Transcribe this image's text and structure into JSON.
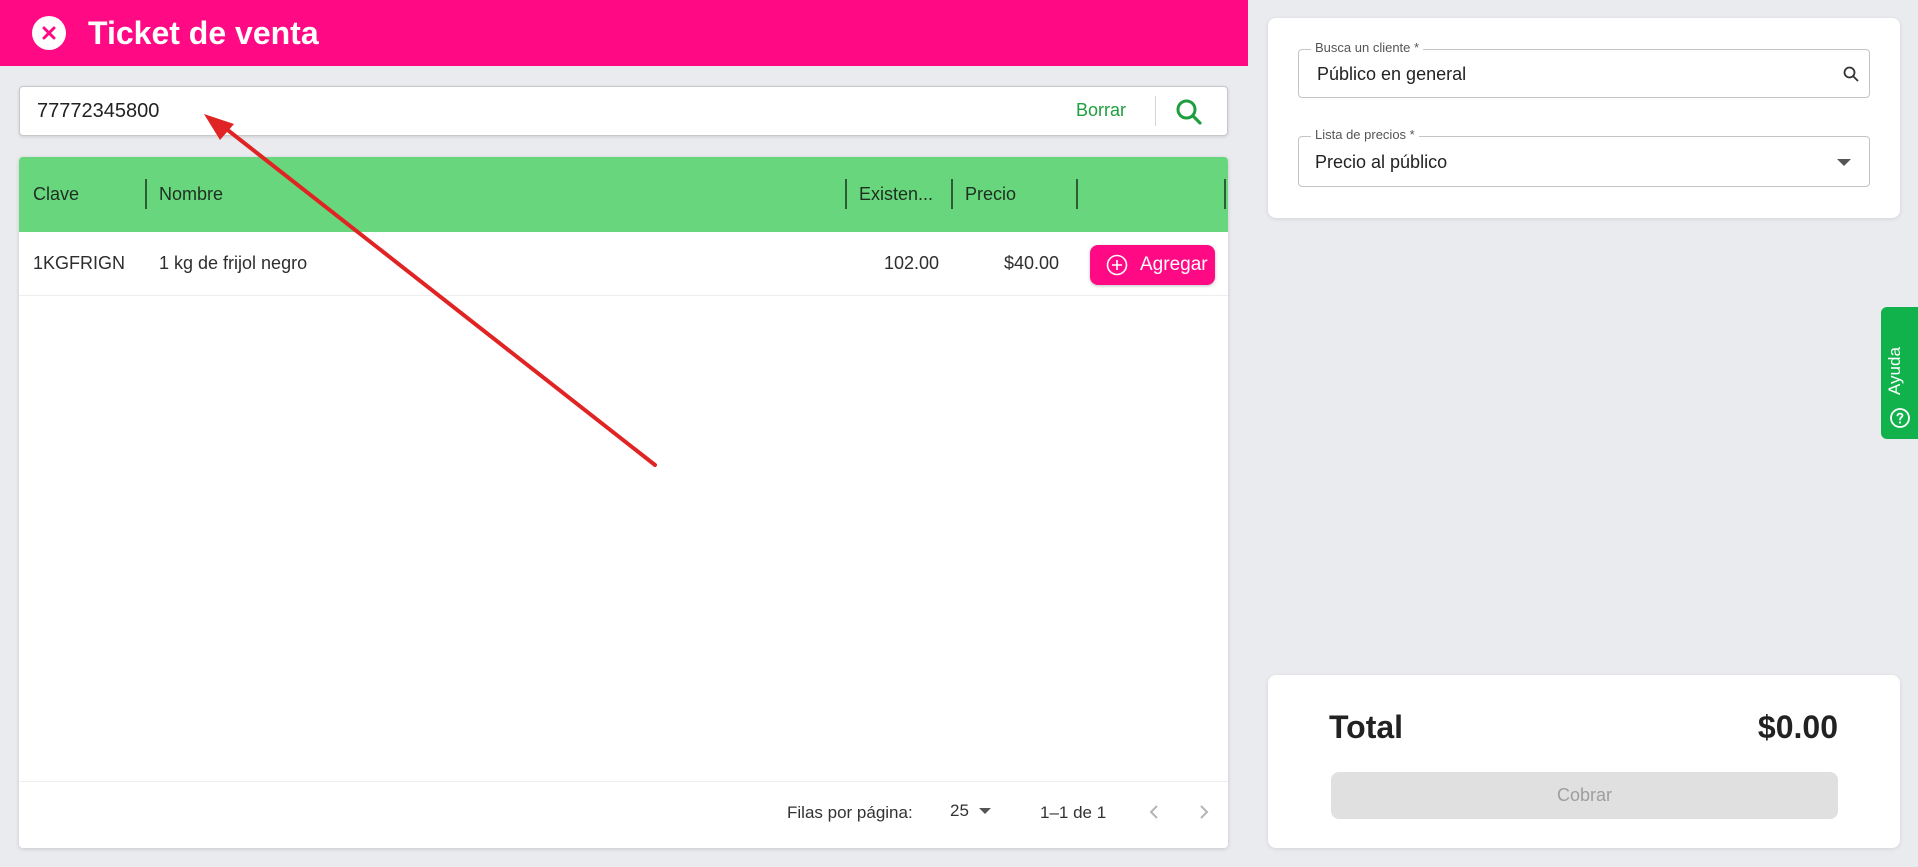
{
  "header": {
    "title": "Ticket de venta"
  },
  "search": {
    "value": "77772345800",
    "clear_label": "Borrar"
  },
  "table": {
    "columns": [
      "Clave",
      "Nombre",
      "Existen...",
      "Precio"
    ],
    "rows": [
      {
        "clave": "1KGFRIGN",
        "nombre": "1 kg de frijol negro",
        "existencia": "102.00",
        "precio": "$40.00",
        "action_label": "Agregar"
      }
    ],
    "pagination": {
      "rows_label": "Filas por página:",
      "rows_value": "25",
      "range": "1–1 de 1"
    }
  },
  "client": {
    "label": "Busca un cliente *",
    "value": "Público en general"
  },
  "price_list": {
    "label": "Lista de precios *",
    "value": "Precio al público"
  },
  "totals": {
    "label": "Total",
    "value": "$0.00",
    "pay_label": "Cobrar"
  },
  "help": {
    "label": "Ayuda"
  },
  "colors": {
    "brand": "#ff0a84",
    "table_header": "#67d67c",
    "success": "#11b24b",
    "annotation_arrow": "#e02424"
  }
}
